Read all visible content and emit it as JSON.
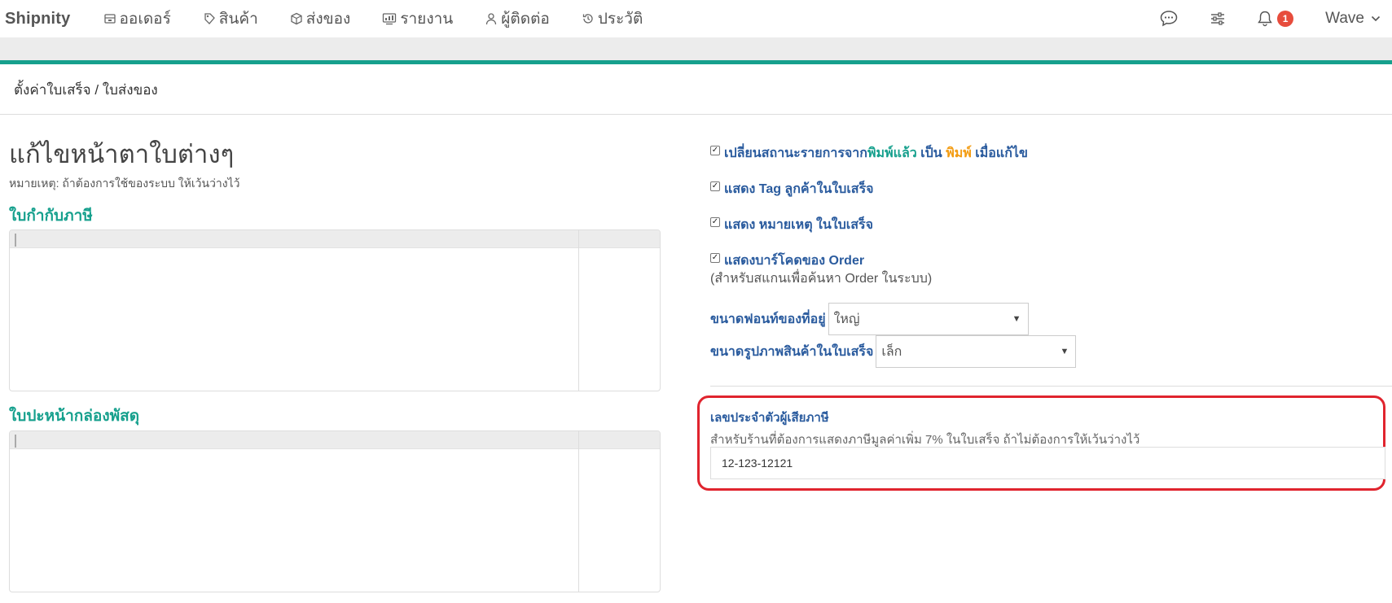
{
  "navbar": {
    "brand": "Shipnity",
    "items": [
      {
        "label": "ออเดอร์",
        "icon": "box-icon"
      },
      {
        "label": "สินค้า",
        "icon": "tag-icon"
      },
      {
        "label": "ส่งของ",
        "icon": "package-icon"
      },
      {
        "label": "รายงาน",
        "icon": "report-icon"
      },
      {
        "label": "ผู้ติดต่อ",
        "icon": "user-icon"
      },
      {
        "label": "ประวัติ",
        "icon": "history-icon"
      }
    ],
    "notification_count": "1",
    "user_name": "Wave"
  },
  "breadcrumb": "ตั้งค่าใบเสร็จ / ใบส่งของ",
  "main": {
    "title": "แก้ไขหน้าตาใบต่างๆ",
    "note": "หมายเหตุ: ถ้าต้องการใช้ของระบบ ให้เว้นว่างไว้",
    "sections": [
      {
        "title": "ใบกำกับภาษี"
      },
      {
        "title": "ใบปะหน้ากล่องพัสดุ"
      }
    ]
  },
  "settings": {
    "change_status": {
      "prefix": "เปลี่ยนสถานะรายการจาก",
      "from": "พิมพ์แล้ว",
      "middle": " เป็น ",
      "to": "พิมพ์",
      "suffix": " เมื่อแก้ไข"
    },
    "show_tag": "แสดง Tag ลูกค้าในใบเสร็จ",
    "show_note": "แสดง หมายเหตุ ในใบเสร็จ",
    "show_barcode": "แสดงบาร์โคดของ Order",
    "barcode_help": "(สำหรับสแกนเพื่อค้นหา Order ในระบบ)",
    "address_font_label": "ขนาดฟอนท์ของที่อยู่",
    "address_font_value": "ใหญ่",
    "image_size_label": "ขนาดรูปภาพสินค้าในใบเสร็จ",
    "image_size_value": "เล็ก",
    "tax_id_label": "เลขประจำตัวผู้เสียภาษี",
    "tax_id_help": "สำหรับร้านที่ต้องการแสดงภาษีมูลค่าเพิ่ม 7% ในใบเสร็จ ถ้าไม่ต้องการให้เว้นว่างไว้",
    "tax_id_value": "12-123-12121"
  },
  "colors": {
    "accent": "#16a08d",
    "label_blue": "#2a5b9e",
    "highlight_red": "#e0242e",
    "orange": "#f39c12",
    "badge_red": "#e74c3c"
  }
}
